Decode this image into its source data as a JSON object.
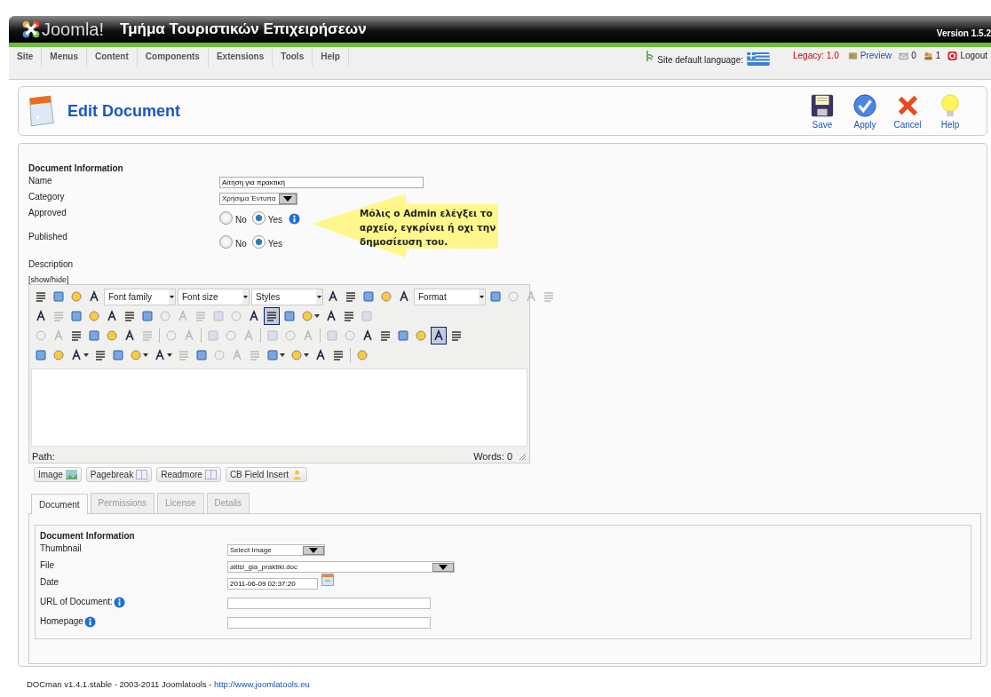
{
  "header": {
    "logo_text": "Joomla!",
    "site_title": "Τμήμα Τουριστικών Επιχειρήσεων",
    "version": "Version 1.5.2"
  },
  "menu": [
    {
      "label": "Site"
    },
    {
      "label": "Menus"
    },
    {
      "label": "Content"
    },
    {
      "label": "Components"
    },
    {
      "label": "Extensions"
    },
    {
      "label": "Tools"
    },
    {
      "label": "Help"
    }
  ],
  "status": {
    "language_label": "Site default language:",
    "legacy": "Legacy: 1.0",
    "preview": "Preview",
    "messages": "0",
    "users": "1",
    "logout": "Logout"
  },
  "page_title": "Edit Document",
  "actions": [
    {
      "kind": "save",
      "label": "Save"
    },
    {
      "kind": "apply",
      "label": "Apply"
    },
    {
      "kind": "cancel",
      "label": "Cancel"
    },
    {
      "kind": "help",
      "label": "Help"
    }
  ],
  "form": {
    "heading": "Document Information",
    "fields": [
      {
        "kind": "text",
        "label": "Name",
        "value": "Αίτηση για πρακτική",
        "info": false
      },
      {
        "kind": "select",
        "label": "Category",
        "value": "Χρήσιμα Έντυπα",
        "info": false
      },
      {
        "kind": "radio",
        "label": "Approved",
        "info": true,
        "options": [
          {
            "label": "No",
            "selected": false
          },
          {
            "label": "Yes",
            "selected": true
          }
        ]
      },
      {
        "kind": "radio",
        "label": "Published",
        "info": false,
        "options": [
          {
            "label": "No",
            "selected": false
          },
          {
            "label": "Yes",
            "selected": true
          }
        ]
      }
    ],
    "description_label": "Description",
    "toggle": "[show/hide]"
  },
  "callout": "Μόλις ο Admin ελέγξει το αρχείο, εγκρίνει ή οχι την δημοσίευση του.",
  "editor": {
    "toolbar": [
      [
        {
          "kind": "button"
        },
        {
          "kind": "button"
        },
        {
          "kind": "button"
        },
        {
          "kind": "button"
        },
        {
          "kind": "select",
          "label": "Font family"
        },
        {
          "kind": "select",
          "label": "Font size"
        },
        {
          "kind": "select",
          "label": "Styles"
        },
        {
          "kind": "button"
        },
        {
          "kind": "button"
        },
        {
          "kind": "button"
        },
        {
          "kind": "button"
        },
        {
          "kind": "button"
        },
        {
          "kind": "select",
          "label": "Format"
        },
        {
          "kind": "button"
        },
        {
          "kind": "dim"
        },
        {
          "kind": "dim"
        },
        {
          "kind": "dim"
        }
      ],
      [
        {
          "kind": "button"
        },
        {
          "kind": "dim"
        },
        {
          "kind": "button"
        },
        {
          "kind": "button"
        },
        {
          "kind": "button"
        },
        {
          "kind": "button"
        },
        {
          "kind": "button"
        },
        {
          "kind": "dim"
        },
        {
          "kind": "dim"
        },
        {
          "kind": "dim"
        },
        {
          "kind": "dim"
        },
        {
          "kind": "dim"
        },
        {
          "kind": "button"
        },
        {
          "kind": "pressed"
        },
        {
          "kind": "button"
        },
        {
          "kind": "split"
        },
        {
          "kind": "button"
        },
        {
          "kind": "button"
        },
        {
          "kind": "dim"
        }
      ],
      [
        {
          "kind": "dim"
        },
        {
          "kind": "dim"
        },
        {
          "kind": "button"
        },
        {
          "kind": "button"
        },
        {
          "kind": "button"
        },
        {
          "kind": "button"
        },
        {
          "kind": "dim"
        },
        {
          "kind": "separator"
        },
        {
          "kind": "dim"
        },
        {
          "kind": "dim"
        },
        {
          "kind": "separator"
        },
        {
          "kind": "dim"
        },
        {
          "kind": "dim"
        },
        {
          "kind": "dim"
        },
        {
          "kind": "separator"
        },
        {
          "kind": "dim"
        },
        {
          "kind": "dim"
        },
        {
          "kind": "dim"
        },
        {
          "kind": "separator"
        },
        {
          "kind": "dim"
        },
        {
          "kind": "dim"
        },
        {
          "kind": "button"
        },
        {
          "kind": "button"
        },
        {
          "kind": "button"
        },
        {
          "kind": "button"
        },
        {
          "kind": "pressed"
        },
        {
          "kind": "button"
        }
      ],
      [
        {
          "kind": "button"
        },
        {
          "kind": "button"
        },
        {
          "kind": "split"
        },
        {
          "kind": "button"
        },
        {
          "kind": "button"
        },
        {
          "kind": "split"
        },
        {
          "kind": "split"
        },
        {
          "kind": "dim"
        },
        {
          "kind": "button"
        },
        {
          "kind": "dim"
        },
        {
          "kind": "dim"
        },
        {
          "kind": "dim"
        },
        {
          "kind": "split"
        },
        {
          "kind": "split"
        },
        {
          "kind": "button"
        },
        {
          "kind": "button"
        },
        {
          "kind": "separator"
        },
        {
          "kind": "button"
        }
      ]
    ],
    "path_label": "Path:",
    "word_count": "Words: 0"
  },
  "editor_buttons": [
    {
      "label": "Image"
    },
    {
      "label": "Pagebreak"
    },
    {
      "label": "Readmore"
    },
    {
      "label": "CB Field Insert"
    }
  ],
  "tabs": [
    {
      "label": "Document",
      "selected": true
    },
    {
      "label": "Permissions",
      "selected": false
    },
    {
      "label": "License",
      "selected": false
    },
    {
      "label": "Details",
      "selected": false
    }
  ],
  "details": {
    "heading": "Document Information",
    "fields": [
      {
        "kind": "select",
        "label": "Thumbnail",
        "value": "Select Image",
        "wide": false,
        "info": false
      },
      {
        "kind": "select",
        "label": "File",
        "value": "aitisi_gia_praktiki.doc",
        "wide": true,
        "info": false
      },
      {
        "kind": "date",
        "label": "Date",
        "value": "2011-06-09 02:37:20",
        "wide": false,
        "info": false
      },
      {
        "kind": "text",
        "label": "URL of Document:",
        "wide": true,
        "info": true
      },
      {
        "kind": "text",
        "label": "Homepage",
        "wide": true,
        "info": true
      }
    ]
  },
  "footer": {
    "text": "DOCman v1.4.1.stable - 2003-2011 Joomlatools - ",
    "link": "http://www.joomlatools.eu"
  }
}
